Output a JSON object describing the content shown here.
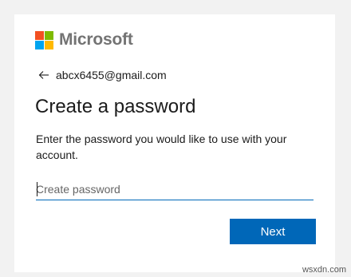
{
  "brand": {
    "name": "Microsoft",
    "logo_colors": [
      "#f25022",
      "#7fba00",
      "#00a4ef",
      "#ffb900"
    ]
  },
  "identity": {
    "email": "abcx6455@gmail.com",
    "back_icon": "back-arrow-icon"
  },
  "page": {
    "title": "Create a password",
    "description": "Enter the password you would like to use with your account."
  },
  "form": {
    "password_placeholder": "Create password",
    "password_value": "",
    "next_label": "Next"
  },
  "colors": {
    "accent": "#0067b8",
    "background": "#f2f2f2",
    "card": "#ffffff"
  },
  "watermark": "wsxdn.com"
}
